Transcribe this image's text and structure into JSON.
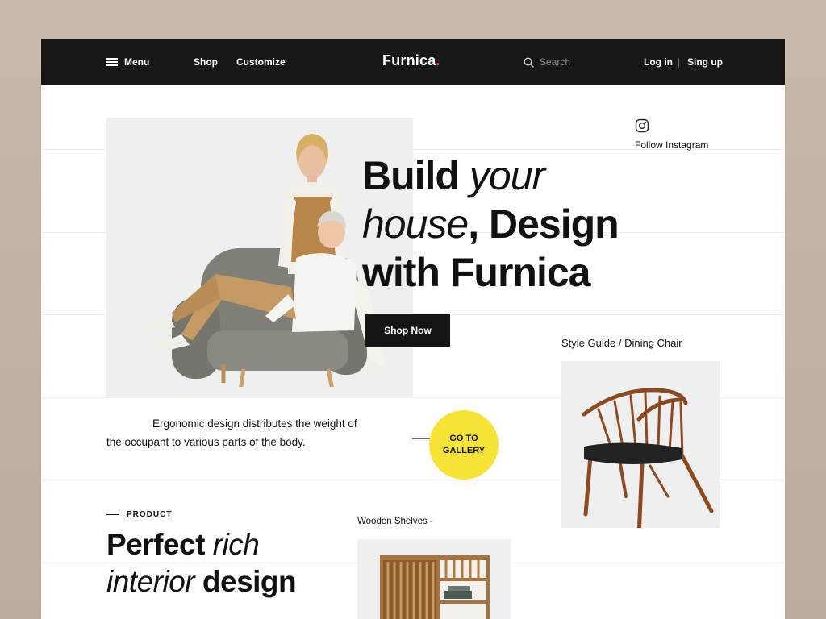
{
  "nav": {
    "menu_label": "Menu",
    "shop_label": "Shop",
    "customize_label": "Customize",
    "logo_text": "Furnica",
    "logo_dot": ".",
    "search_placeholder": "Search",
    "login_label": "Log in",
    "separator": "|",
    "signup_label": "Sing up",
    "colors": {
      "bar": "#181818",
      "logo_dot": "#e8412c"
    }
  },
  "hero": {
    "headline_line1_bold": "Build",
    "headline_line1_italic": "your",
    "headline_line2_italic": "house",
    "headline_line2_bold": ", Design",
    "headline_line3_bold": "with Furnica",
    "cta_label": "Shop Now"
  },
  "social": {
    "icon": "instagram-icon",
    "label": "Follow Instagram"
  },
  "style_guide": {
    "label": "Style Guide",
    "separator": "/",
    "item": "Dining Chair"
  },
  "description": {
    "text_line1": "Ergonomic design distributes the weight of",
    "text_line2": "the occupant to various parts of the body."
  },
  "gallery_button": {
    "label": "GO TO\nGALLERY",
    "color": "#f7e236"
  },
  "product": {
    "tag": "PRODUCT",
    "title_bold1": "Perfect",
    "title_italic1": "rich",
    "title_italic2": "interior",
    "title_bold2": "design"
  },
  "shelves": {
    "label": "Wooden Shelves -"
  }
}
